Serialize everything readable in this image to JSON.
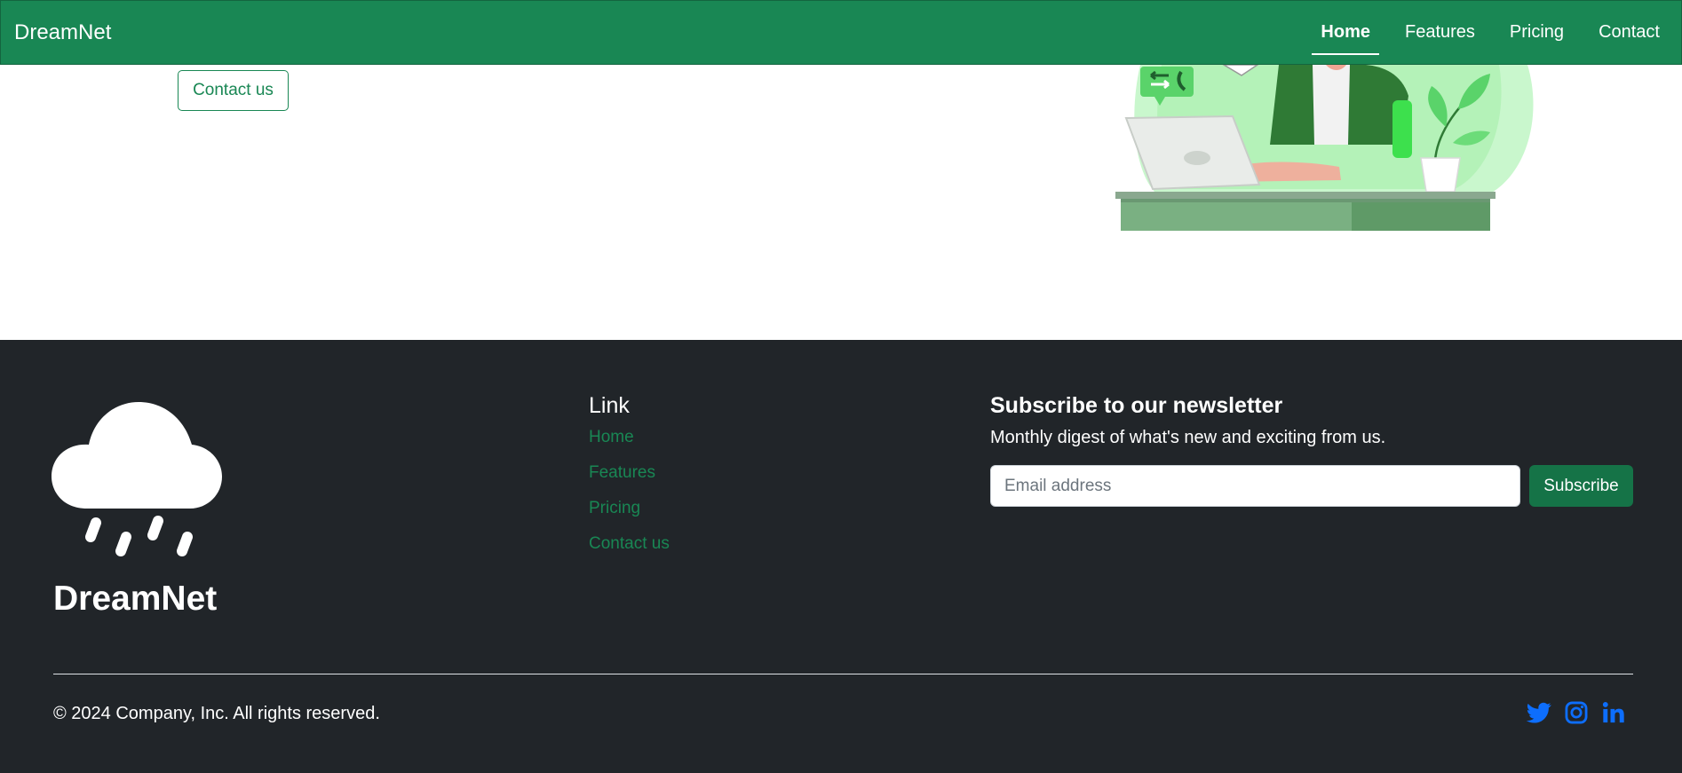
{
  "nav": {
    "brand": "DreamNet",
    "items": [
      {
        "label": "Home",
        "active": true
      },
      {
        "label": "Features"
      },
      {
        "label": "Pricing"
      },
      {
        "label": "Contact"
      }
    ]
  },
  "hero": {
    "contact_button": "Contact us",
    "illustration": "person-at-laptop-illustration"
  },
  "footer": {
    "brand": "DreamNet",
    "logo_icon": "cloud-rain-icon",
    "links_title": "Link",
    "links": [
      "Home",
      "Features",
      "Pricing",
      "Contact us"
    ],
    "newsletter": {
      "title": "Subscribe to our newsletter",
      "description": "Monthly digest of what's new and exciting from us.",
      "email_placeholder": "Email address",
      "button": "Subscribe"
    },
    "copyright": "© 2024 Company, Inc. All rights reserved.",
    "socials": [
      "twitter-icon",
      "instagram-icon",
      "linkedin-icon"
    ]
  },
  "colors": {
    "primary": "#198754",
    "dark": "#212529",
    "social": "#0d6efd"
  }
}
